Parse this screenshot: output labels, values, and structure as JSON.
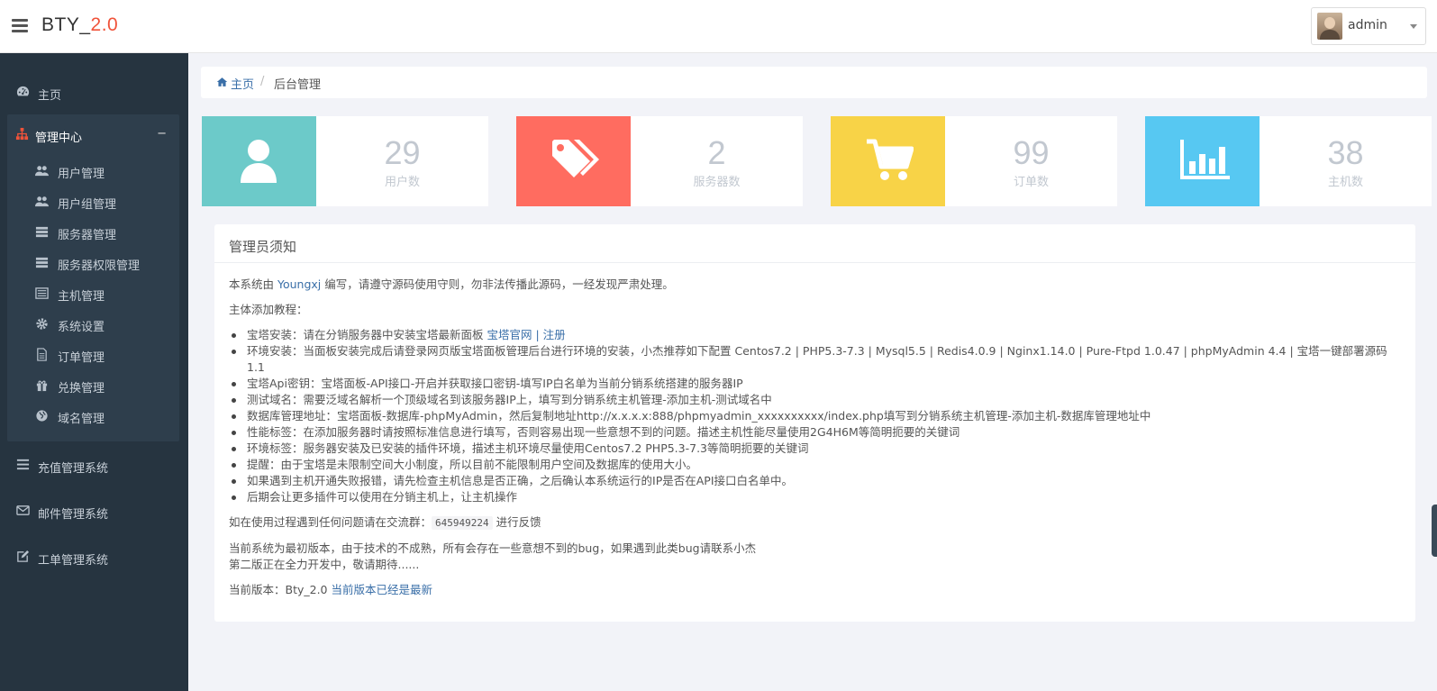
{
  "brand": {
    "name": "BTY_",
    "version": "2.0"
  },
  "user": {
    "name": "admin"
  },
  "sidebar": {
    "home": "主页",
    "group": {
      "label": "管理中心",
      "toggle": "−",
      "items": [
        {
          "label": "用户管理",
          "icon": "users-icon"
        },
        {
          "label": "用户组管理",
          "icon": "users-icon"
        },
        {
          "label": "服务器管理",
          "icon": "server-icon"
        },
        {
          "label": "服务器权限管理",
          "icon": "server-icon"
        },
        {
          "label": "主机管理",
          "icon": "list-icon"
        },
        {
          "label": "系统设置",
          "icon": "gear-icon"
        },
        {
          "label": "订单管理",
          "icon": "file-icon"
        },
        {
          "label": "兑换管理",
          "icon": "gift-icon"
        },
        {
          "label": "域名管理",
          "icon": "globe-icon"
        }
      ]
    },
    "bottom": [
      {
        "label": "充值管理系统",
        "icon": "bars-icon"
      },
      {
        "label": "邮件管理系统",
        "icon": "mail-icon"
      },
      {
        "label": "工单管理系统",
        "icon": "edit-icon"
      }
    ]
  },
  "breadcrumb": {
    "home": "主页",
    "sep": "/",
    "current": "后台管理"
  },
  "stats": [
    {
      "value": "29",
      "label": "用户数",
      "color": "#6ccac9",
      "icon": "user-icon"
    },
    {
      "value": "2",
      "label": "服务器数",
      "color": "#ff6c60",
      "icon": "tags-icon"
    },
    {
      "value": "99",
      "label": "订单数",
      "color": "#f8d347",
      "icon": "cart-icon"
    },
    {
      "value": "38",
      "label": "主机数",
      "color": "#57c8f2",
      "icon": "bar-chart-icon"
    }
  ],
  "notice": {
    "title": "管理员须知",
    "intro_pre": "本系统由 ",
    "intro_author": "Youngxj",
    "intro_post": " 编写，请遵守源码使用守则，勿非法传播此源码，一经发现严肃处理。",
    "tutorial": "主体添加教程：",
    "tip1_pre": "宝塔安装：请在分销服务器中安装宝塔最新面板 ",
    "tip1_link1": "宝塔官网",
    "tip1_sep": " | ",
    "tip1_link2": "注册",
    "tips": [
      "环境安装：当面板安装完成后请登录网页版宝塔面板管理后台进行环境的安装，小杰推荐如下配置 Centos7.2 | PHP5.3-7.3 | Mysql5.5 | Redis4.0.9 | Nginx1.14.0 | Pure-Ftpd 1.0.47 | phpMyAdmin 4.4 | 宝塔一键部署源码1.1",
      "宝塔Api密钥：宝塔面板-API接口-开启并获取接口密钥-填写IP白名单为当前分销系统搭建的服务器IP",
      "测试域名：需要泛域名解析一个顶级域名到该服务器IP上，填写到分销系统主机管理-添加主机-测试域名中",
      "数据库管理地址：宝塔面板-数据库-phpMyAdmin，然后复制地址http://x.x.x.x:888/phpmyadmin_xxxxxxxxxx/index.php填写到分销系统主机管理-添加主机-数据库管理地址中",
      "性能标签：在添加服务器时请按照标准信息进行填写，否则容易出现一些意想不到的问题。描述主机性能尽量使用2G4H6M等简明扼要的关键词",
      "环境标签：服务器安装及已安装的插件环境，描述主机环境尽量使用Centos7.2 PHP5.3-7.3等简明扼要的关键词",
      "提醒：由于宝塔是未限制空间大小制度，所以目前不能限制用户空间及数据库的使用大小。",
      "如果遇到主机开通失败报错，请先检查主机信息是否正确，之后确认本系统运行的IP是否在API接口白名单中。",
      "后期会让更多插件可以使用在分销主机上，让主机操作"
    ],
    "group_pre": "如在使用过程遇到任何问题请在交流群：",
    "group_code": "645949224",
    "group_post": " 进行反馈",
    "version_note1": "当前系统为最初版本，由于技术的不成熟，所有会存在一些意想不到的bug，如果遇到此类bug请联系小杰",
    "version_note2": "第二版正在全力开发中，敬请期待......",
    "current_pre": "当前版本：Bty_2.0 ",
    "current_link": "当前版本已经是最新"
  }
}
